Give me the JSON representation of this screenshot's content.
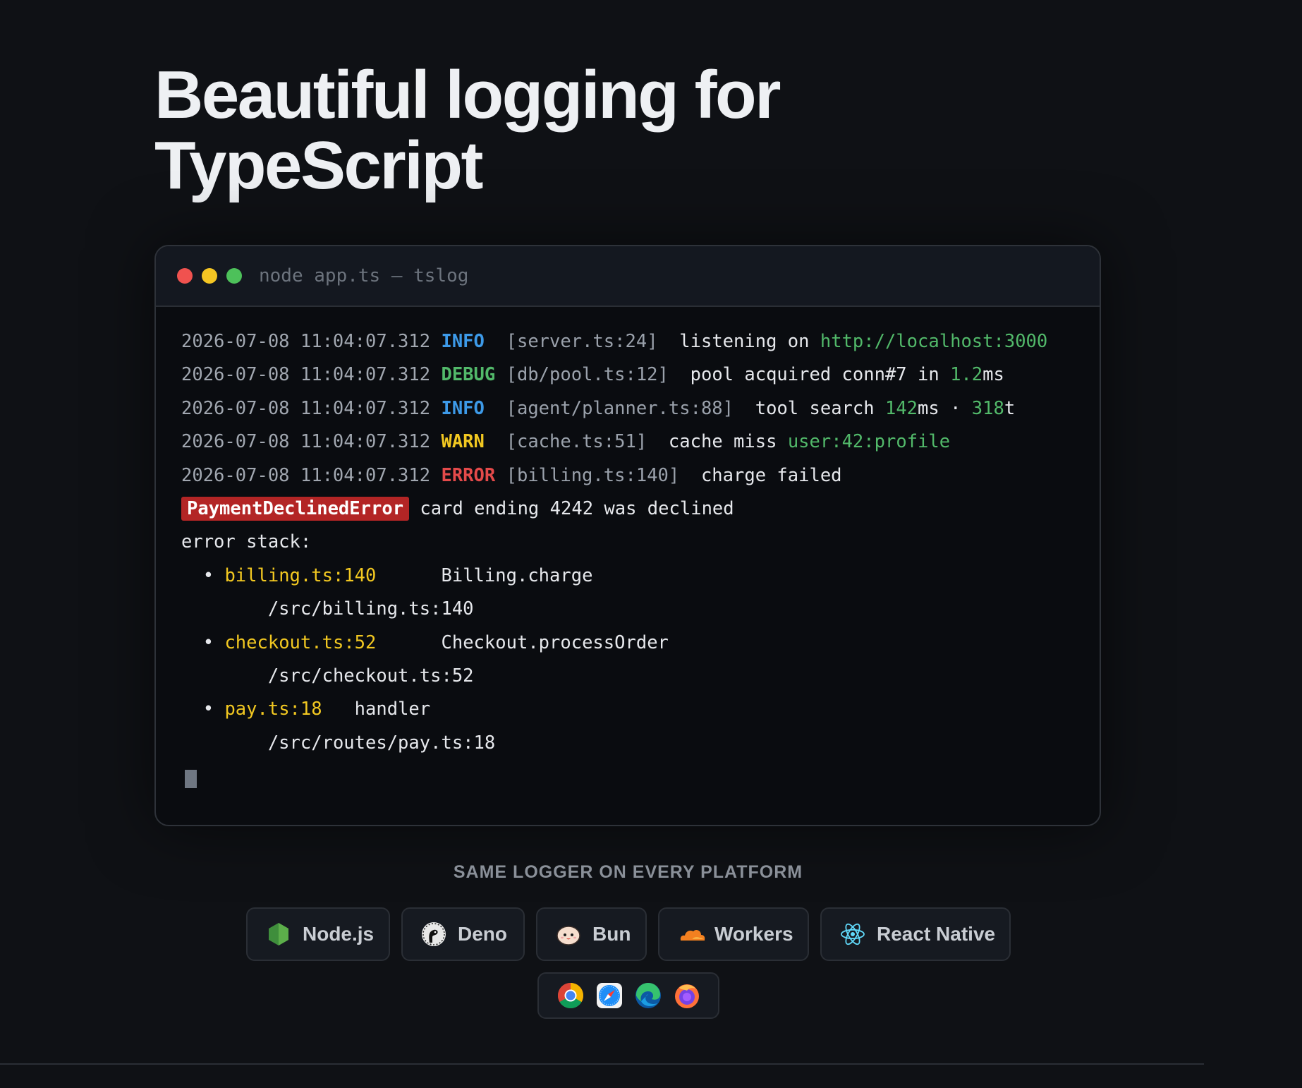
{
  "hero": {
    "title_line1": "Beautiful logging for",
    "title_line2": "TypeScript"
  },
  "terminal": {
    "title": "node app.ts — tslog",
    "window_controls": [
      "close",
      "minimize",
      "maximize"
    ],
    "logs": [
      {
        "timestamp": "2026-07-08 11:04:07.312",
        "level": "INFO",
        "source": "[server.ts:24]",
        "message": "listening on ",
        "url": "http://localhost:3000"
      },
      {
        "timestamp": "2026-07-08 11:04:07.312",
        "level": "DEBUG",
        "source": "[db/pool.ts:12]",
        "message": "pool acquired conn#7 in ",
        "value": "1.2",
        "unit": "ms"
      },
      {
        "timestamp": "2026-07-08 11:04:07.312",
        "level": "INFO",
        "source": "[agent/planner.ts:88]",
        "message": "tool search ",
        "value1": "142",
        "unit1": "ms · ",
        "value2": "318",
        "unit2": "t"
      },
      {
        "timestamp": "2026-07-08 11:04:07.312",
        "level": "WARN",
        "source": "[cache.ts:51]",
        "message": "cache miss ",
        "key": "user:42:profile"
      },
      {
        "timestamp": "2026-07-08 11:04:07.312",
        "level": "ERROR",
        "source": "[billing.ts:140]",
        "message": "charge failed"
      }
    ],
    "error": {
      "name": "PaymentDeclinedError",
      "message": "card ending 4242 was declined",
      "stack_label": "error stack:",
      "frames": [
        {
          "location": "billing.ts:140",
          "function": "Billing.charge",
          "path": "/src/billing.ts:140"
        },
        {
          "location": "checkout.ts:52",
          "function": "Checkout.processOrder",
          "path": "/src/checkout.ts:52"
        },
        {
          "location": "pay.ts:18",
          "function": "handler",
          "path": "/src/routes/pay.ts:18"
        }
      ]
    }
  },
  "platforms": {
    "heading": "SAME LOGGER ON EVERY PLATFORM",
    "items": [
      {
        "label": "Node.js",
        "icon": "nodejs-icon"
      },
      {
        "label": "Deno",
        "icon": "deno-icon"
      },
      {
        "label": "Bun",
        "icon": "bun-icon"
      },
      {
        "label": "Workers",
        "icon": "cloudflare-icon"
      },
      {
        "label": "React Native",
        "icon": "react-icon"
      }
    ],
    "browsers": [
      "chrome-icon",
      "safari-icon",
      "edge-icon",
      "firefox-icon"
    ]
  },
  "colors": {
    "background": "#0f1115",
    "info": "#3d9ae8",
    "debug": "#52b96a",
    "warn": "#f2c821",
    "error": "#e44a4a",
    "error_badge": "#b32525"
  }
}
